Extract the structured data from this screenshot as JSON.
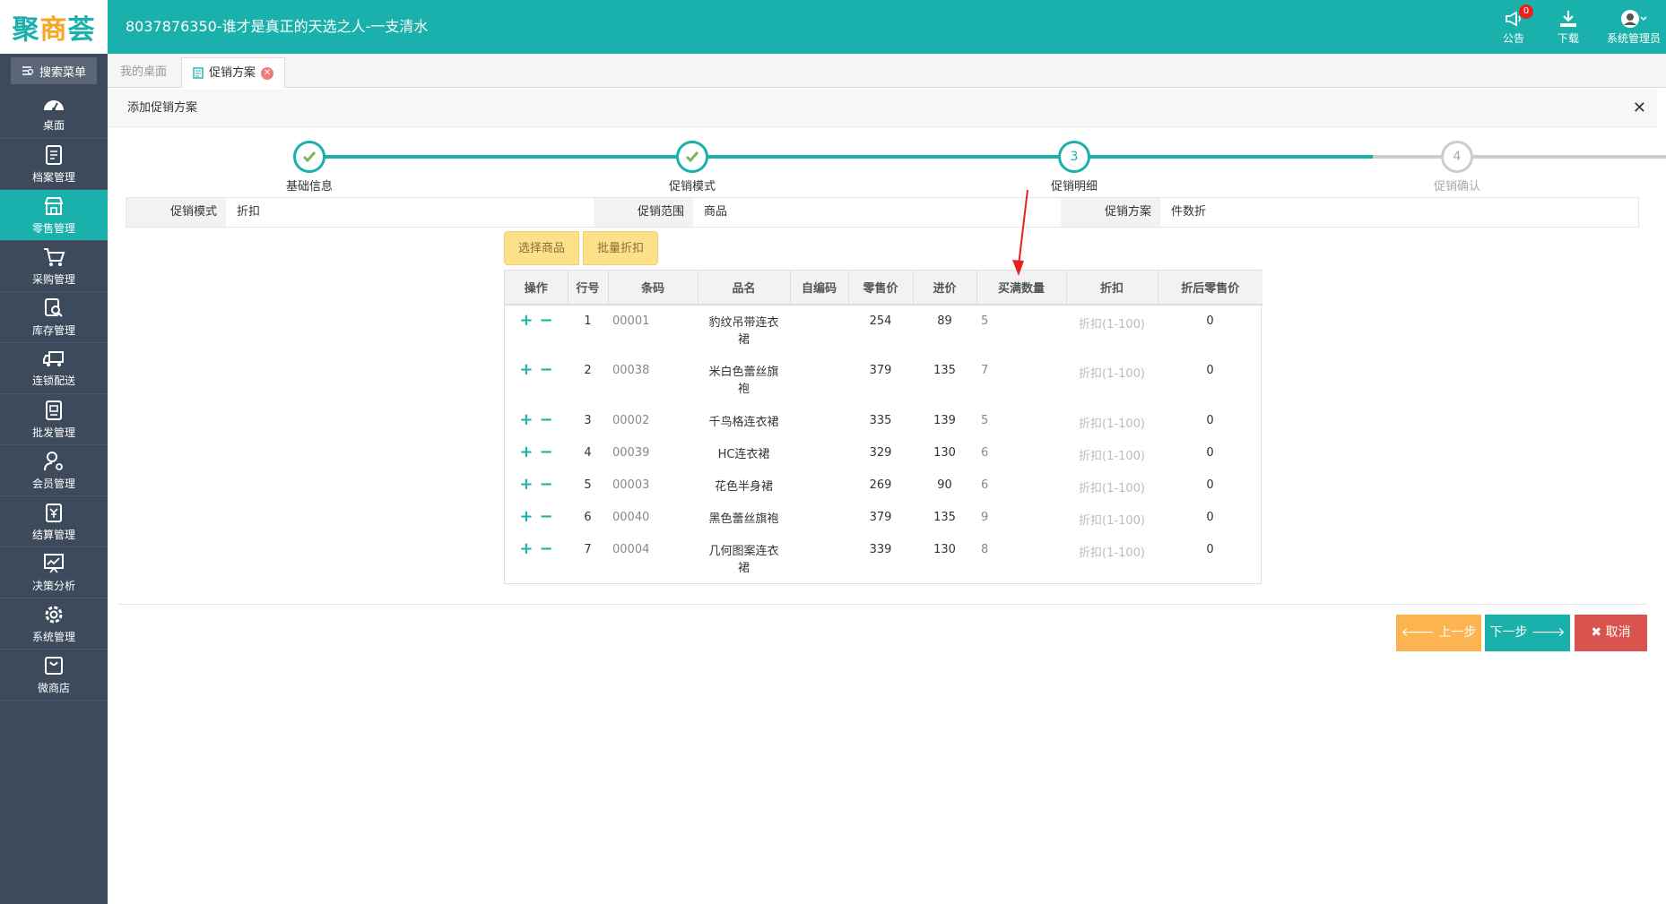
{
  "header": {
    "logo": {
      "part1": "聚",
      "part2": "商",
      "part3": "荟"
    },
    "title": "8037876350-谁才是真正的天选之人-一支清水",
    "notice_label": "公告",
    "notice_badge": "0",
    "download_label": "下载",
    "user_label": "系统管理员",
    "accent_color": "#1ab0ab"
  },
  "sidebar": {
    "search_label": "搜索菜单",
    "items": [
      {
        "label": "桌面",
        "icon": "dashboard-icon"
      },
      {
        "label": "档案管理",
        "icon": "archive-icon"
      },
      {
        "label": "零售管理",
        "icon": "store-icon",
        "active": true
      },
      {
        "label": "采购管理",
        "icon": "cart-icon"
      },
      {
        "label": "库存管理",
        "icon": "inventory-icon"
      },
      {
        "label": "连锁配送",
        "icon": "truck-icon"
      },
      {
        "label": "批发管理",
        "icon": "wholesale-icon"
      },
      {
        "label": "会员管理",
        "icon": "member-icon"
      },
      {
        "label": "结算管理",
        "icon": "settlement-icon"
      },
      {
        "label": "决策分析",
        "icon": "analysis-icon"
      },
      {
        "label": "系统管理",
        "icon": "gear-icon"
      },
      {
        "label": "微商店",
        "icon": "shop-bag-icon"
      }
    ]
  },
  "tabs": [
    {
      "label": "我的桌面"
    },
    {
      "label": "促销方案",
      "active": true
    }
  ],
  "panel": {
    "title": "添加促销方案"
  },
  "steps": [
    {
      "label": "基础信息",
      "state": "done"
    },
    {
      "label": "促销模式",
      "state": "done"
    },
    {
      "label": "促销明细",
      "number": "3",
      "state": "current"
    },
    {
      "label": "促销确认",
      "number": "4",
      "state": "pending"
    }
  ],
  "info": {
    "mode_label": "促销模式",
    "mode_value": "折扣",
    "scope_label": "促销范围",
    "scope_value": "商品",
    "plan_label": "促销方案",
    "plan_value": "件数折"
  },
  "actions": {
    "select_goods": "选择商品",
    "batch_discount": "批量折扣"
  },
  "table": {
    "headers": [
      "操作",
      "行号",
      "条码",
      "品名",
      "自编码",
      "零售价",
      "进价",
      "买满数量",
      "折扣",
      "折后零售价"
    ],
    "op_plus": "+",
    "op_minus": "−",
    "rows": [
      {
        "no": "1",
        "barcode": "00001",
        "name1": "豹纹吊带连衣",
        "name2": "裙",
        "code": "",
        "retail": "254",
        "cost": "89",
        "qty": "5",
        "discount": "折扣(1-100)",
        "final": "0"
      },
      {
        "no": "2",
        "barcode": "00038",
        "name1": "米白色蕾丝旗",
        "name2": "袍",
        "code": "",
        "retail": "379",
        "cost": "135",
        "qty": "7",
        "discount": "折扣(1-100)",
        "final": "0"
      },
      {
        "no": "3",
        "barcode": "00002",
        "name1": "千鸟格连衣裙",
        "name2": "",
        "code": "",
        "retail": "335",
        "cost": "139",
        "qty": "5",
        "discount": "折扣(1-100)",
        "final": "0"
      },
      {
        "no": "4",
        "barcode": "00039",
        "name1": "HC连衣裙",
        "name2": "",
        "code": "",
        "retail": "329",
        "cost": "130",
        "qty": "6",
        "discount": "折扣(1-100)",
        "final": "0"
      },
      {
        "no": "5",
        "barcode": "00003",
        "name1": "花色半身裙",
        "name2": "",
        "code": "",
        "retail": "269",
        "cost": "90",
        "qty": "6",
        "discount": "折扣(1-100)",
        "final": "0"
      },
      {
        "no": "6",
        "barcode": "00040",
        "name1": "黑色蕾丝旗袍",
        "name2": "",
        "code": "",
        "retail": "379",
        "cost": "135",
        "qty": "9",
        "discount": "折扣(1-100)",
        "final": "0"
      },
      {
        "no": "7",
        "barcode": "00004",
        "name1": "几何图案连衣",
        "name2": "裙",
        "code": "",
        "retail": "339",
        "cost": "130",
        "qty": "8",
        "discount": "折扣(1-100)",
        "final": "0"
      }
    ]
  },
  "footer": {
    "prev": "上一步",
    "next": "下一步",
    "cancel": "取消"
  }
}
